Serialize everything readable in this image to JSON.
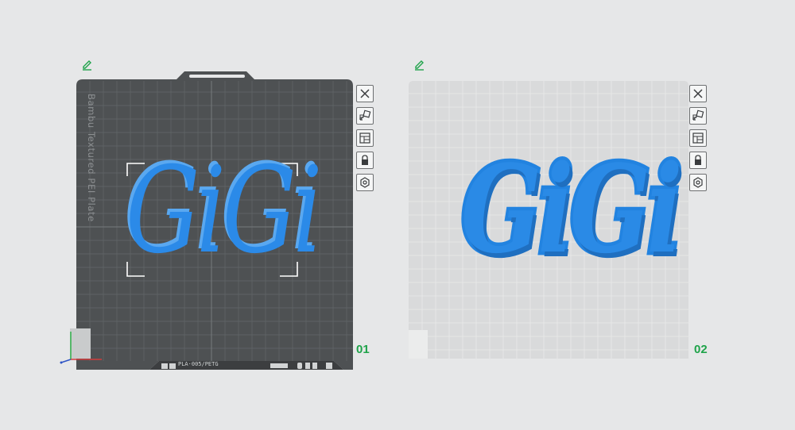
{
  "plates": [
    {
      "label": "01",
      "plate_name": "Bambu Textured PEI Plate",
      "model_text": "GiGi",
      "status_text": "PLA·005/PETG",
      "selected": true
    },
    {
      "label": "02",
      "model_text": "GiGi",
      "selected": false
    }
  ],
  "toolbar": [
    "close-icon",
    "arrange-icon",
    "layout-icon",
    "lock-icon",
    "settings-icon"
  ],
  "colors": {
    "background": "#e6e7e8",
    "plate_dark": "#4e5153",
    "plate_light": "#d9dadb",
    "model_blue": "#2b8ae8",
    "label_green": "#1fa34a",
    "edit_green": "#1fa34a"
  }
}
